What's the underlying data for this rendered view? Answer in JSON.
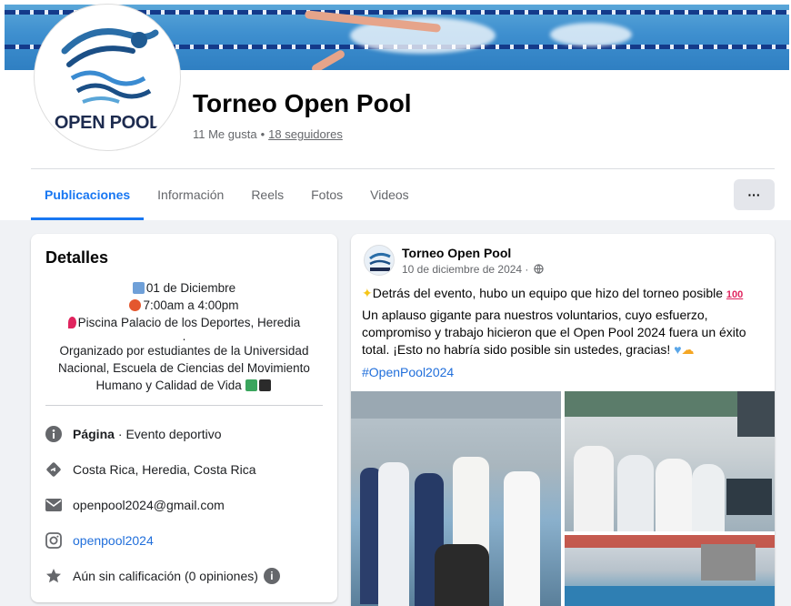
{
  "page": {
    "avatar_text": "OPEN POOL",
    "name": "Torneo Open Pool",
    "likes": "11 Me gusta",
    "separator": "•",
    "followers": "18 seguidores"
  },
  "tabs": [
    "Publicaciones",
    "Información",
    "Reels",
    "Fotos",
    "Videos"
  ],
  "more_button": "···",
  "details": {
    "title": "Detalles",
    "date": "01 de Diciembre",
    "time": "7:00am a 4:00pm",
    "place": "Piscina Palacio de los Deportes, Heredia",
    "dot": ".",
    "organizer": "Organizado por estudiantes de la Universidad Nacional, Escuela de Ciencias del Movimiento Humano y Calidad de Vida",
    "category_label": "Página",
    "category_value": "· Evento deportivo",
    "location": "Costa Rica, Heredia, Costa Rica",
    "email": "openpool2024@gmail.com",
    "instagram": "openpool2024",
    "rating": "Aún sin calificación (0 opiniones)"
  },
  "post": {
    "author": "Torneo Open Pool",
    "date": "10 de diciembre de 2024 ·",
    "line1": "Detrás del evento, hubo un equipo que hizo del torneo posible",
    "body": "Un aplauso gigante para nuestros voluntarios, cuyo esfuerzo, compromiso y trabajo hicieron que el Open Pool 2024 fuera un éxito total. ¡Esto no habría sido posible sin ustedes, gracias!",
    "hashtag": "#OpenPool2024"
  },
  "colors": {
    "accent": "#1877f2",
    "link": "#216fdb",
    "background": "#f0f2f5"
  }
}
